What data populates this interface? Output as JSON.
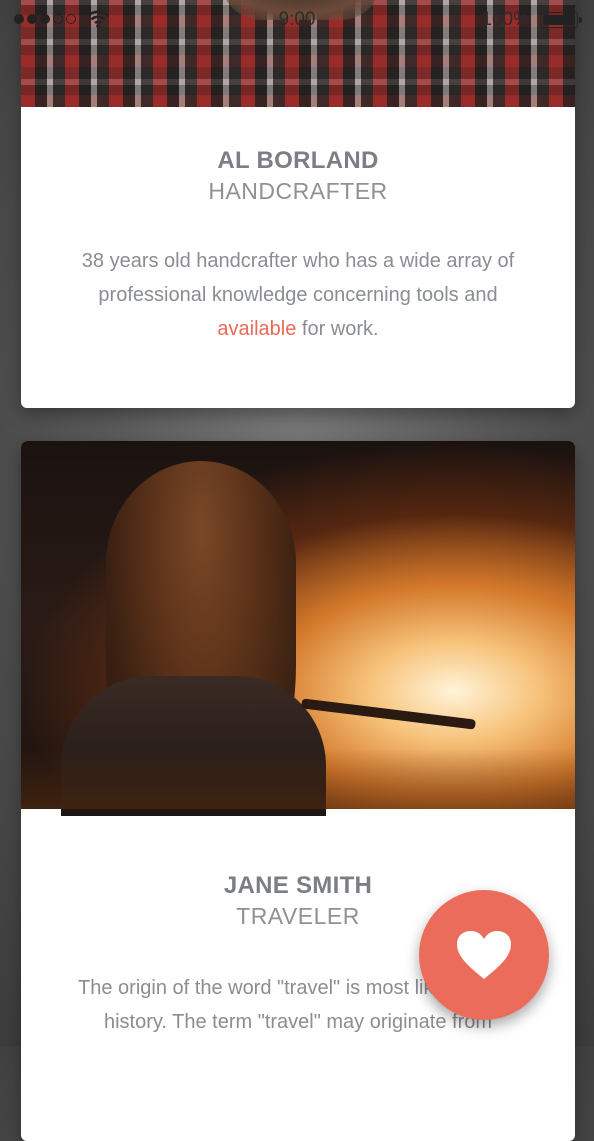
{
  "status_bar": {
    "time": "9:00",
    "battery": "100%",
    "signal_dots_filled": 3,
    "signal_dots_total": 5
  },
  "cards": [
    {
      "name": "AL BORLAND",
      "role": "HANDCRAFTER",
      "bio_before": "38 years old handcrafter who has a wide array of professional knowledge concerning tools and ",
      "bio_highlight": "available",
      "bio_after": " for work."
    },
    {
      "name": "JANE SMITH",
      "role": "TRAVELER",
      "bio": "The origin of the word \"travel\" is most likely lost to history.  The term \"travel\" may originate from"
    }
  ],
  "fab": {
    "icon": "heart-icon"
  },
  "colors": {
    "accent": "#ea6a57",
    "fab": "#ec6c5c",
    "text": "#8a8d93"
  }
}
